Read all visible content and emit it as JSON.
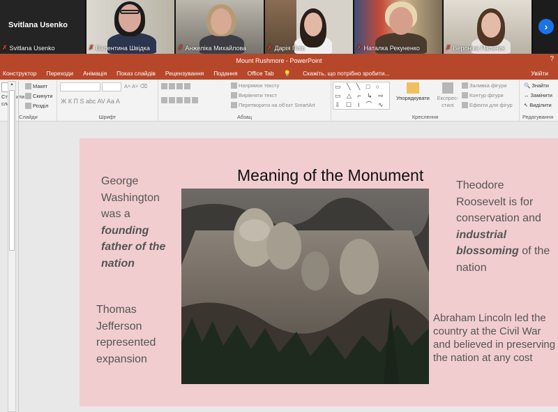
{
  "call": {
    "participants": [
      {
        "name": "Svitlana Usenko",
        "label": "Svitlana Usenko"
      },
      {
        "name": "Валентина Швідка"
      },
      {
        "name": "Анжеліка Михайлова"
      },
      {
        "name": "Дарія Пліс"
      },
      {
        "name": "Наталка Рекуненко"
      },
      {
        "name": "Вероніка Пальчик"
      }
    ]
  },
  "app": {
    "window_title": "Mount Rushmore - PowerPoint",
    "tabs": [
      "Конструктор",
      "Переходи",
      "Анімація",
      "Показ слайдів",
      "Рецензування",
      "Подання",
      "Office Tab"
    ],
    "tell_me": "Скажіть, що потрібно зробити...",
    "share": "Увійти"
  },
  "ribbon": {
    "slides": {
      "new_slide": "Створити слайд",
      "layout": "Макет",
      "reset": "Скинути",
      "section": "Розділ",
      "label": "Слайди"
    },
    "font": {
      "label": "Шрифт",
      "format_row": "Ж К П S abc AV Aa A"
    },
    "paragraph": {
      "text_direction": "Напрямок тексту",
      "align_text": "Вирівняти текст",
      "convert_smartart": "Перетворити на об'єкт SmartArt",
      "label": "Абзац"
    },
    "drawing": {
      "arrange": "Упорядкувати",
      "quick_styles": "Експрес-стилі",
      "fill": "Заливка фігури",
      "outline": "Контур фігури",
      "effects": "Ефекти для фігур",
      "label": "Креслення",
      "shapes": "▭ ╲ ╲ □ ○ ▭ △ ⌐ ↳ ⇨ ⇩ ☐ ≀ ⌒ ∿ { } ☆"
    },
    "editing": {
      "find": "Знайти",
      "replace": "Замінити",
      "select": "Виділити",
      "label": "Редагування"
    }
  },
  "slide": {
    "title": "Meaning of the Monument",
    "washington": {
      "pre": "George Washington was a ",
      "emph": "founding father of the nation"
    },
    "roosevelt": {
      "pre": "Theodore Roosevelt is for conservation and ",
      "emph": "industrial blossoming",
      "post": " of the nation"
    },
    "jefferson": "Thomas Jefferson represented expansion",
    "lincoln": "Abraham Lincoln  led the country at the Civil War and believed in preserving the nation at any cost"
  },
  "colors": {
    "ribbon_accent": "#b7472a",
    "slide_bg": "#f1cdcf",
    "mic_off": "#e0382f",
    "next_button": "#1a73e8"
  }
}
